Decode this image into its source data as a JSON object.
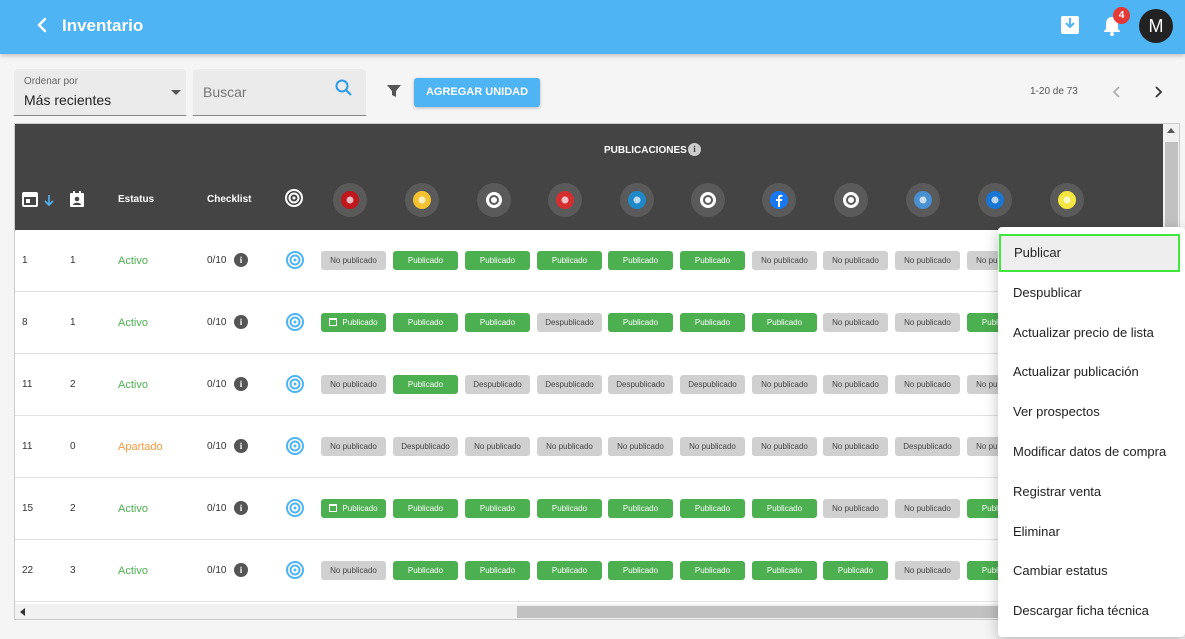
{
  "appbar": {
    "title": "Inventario",
    "notification_count": "4",
    "avatar_initial": "M",
    "color": "#4eb4f3"
  },
  "toolbar": {
    "sort_label": "Ordenar por",
    "sort_value": "Más recientes",
    "search_placeholder": "Buscar",
    "add_button": "AGREGAR UNIDAD",
    "pagination": "1-20 de 73"
  },
  "table": {
    "publications_title": "PUBLICACIONES",
    "headers": {
      "status": "Estatus",
      "checklist": "Checklist"
    },
    "portals": [
      {
        "name": "portal-1",
        "color": "#c0161c"
      },
      {
        "name": "portal-2",
        "color": "#f2c230"
      },
      {
        "name": "portal-3",
        "color": "#ffffff"
      },
      {
        "name": "portal-4",
        "color": "#d32f2f"
      },
      {
        "name": "portal-5",
        "color": "#1e88c8"
      },
      {
        "name": "portal-6",
        "color": "#ffffff"
      },
      {
        "name": "portal-facebook",
        "color": "#1877f2"
      },
      {
        "name": "portal-8",
        "color": "#ffffff"
      },
      {
        "name": "portal-9",
        "color": "#4a8fd0"
      },
      {
        "name": "portal-10",
        "color": "#1976d2"
      },
      {
        "name": "portal-11",
        "color": "#f5e642"
      }
    ],
    "rows": [
      {
        "col1": "1",
        "col2": "1",
        "status": "Activo",
        "status_type": "activo",
        "checklist": "0/10",
        "pubs": [
          "No publicado",
          "Publicado",
          "Publicado",
          "Publicado",
          "Publicado",
          "Publicado",
          "No publicado",
          "No publicado",
          "No publicado",
          "No publicado"
        ],
        "scheduled": []
      },
      {
        "col1": "8",
        "col2": "1",
        "status": "Activo",
        "status_type": "activo",
        "checklist": "0/10",
        "pubs": [
          "Publicado",
          "Publicado",
          "Publicado",
          "Despublicado",
          "Publicado",
          "Publicado",
          "Publicado",
          "No publicado",
          "No publicado",
          "Publicado"
        ],
        "scheduled": [
          0
        ]
      },
      {
        "col1": "11",
        "col2": "2",
        "status": "Activo",
        "status_type": "activo",
        "checklist": "0/10",
        "pubs": [
          "No publicado",
          "Publicado",
          "Despublicado",
          "Despublicado",
          "Despublicado",
          "Despublicado",
          "No publicado",
          "No publicado",
          "No publicado",
          "No publicado"
        ],
        "scheduled": []
      },
      {
        "col1": "11",
        "col2": "0",
        "status": "Apartado",
        "status_type": "apartado",
        "checklist": "0/10",
        "pubs": [
          "No publicado",
          "Despublicado",
          "No publicado",
          "No publicado",
          "No publicado",
          "No publicado",
          "No publicado",
          "No publicado",
          "Despublicado",
          "No publicado"
        ],
        "scheduled": []
      },
      {
        "col1": "15",
        "col2": "2",
        "status": "Activo",
        "status_type": "activo",
        "checklist": "0/10",
        "pubs": [
          "Publicado",
          "Publicado",
          "Publicado",
          "Publicado",
          "Publicado",
          "Publicado",
          "Publicado",
          "No publicado",
          "No publicado",
          "Publicado"
        ],
        "scheduled": [
          0
        ]
      },
      {
        "col1": "22",
        "col2": "3",
        "status": "Activo",
        "status_type": "activo",
        "checklist": "0/10",
        "pubs": [
          "No publicado",
          "Publicado",
          "Publicado",
          "Publicado",
          "Publicado",
          "Publicado",
          "Publicado",
          "Publicado",
          "No publicado",
          "Publicado"
        ],
        "scheduled": []
      }
    ]
  },
  "context_menu": {
    "items": [
      "Publicar",
      "Despublicar",
      "Actualizar precio de lista",
      "Actualizar publicación",
      "Ver prospectos",
      "Modificar datos de compra",
      "Registrar venta",
      "Eliminar",
      "Cambiar estatus",
      "Descargar ficha técnica"
    ],
    "highlighted_index": 0,
    "highlight_color": "#3ee63e"
  },
  "colors": {
    "published": "#4caf50",
    "unpublished": "#d0d0d0",
    "active": "#4caf50",
    "reserved": "#f39a3c",
    "header": "#444444"
  }
}
